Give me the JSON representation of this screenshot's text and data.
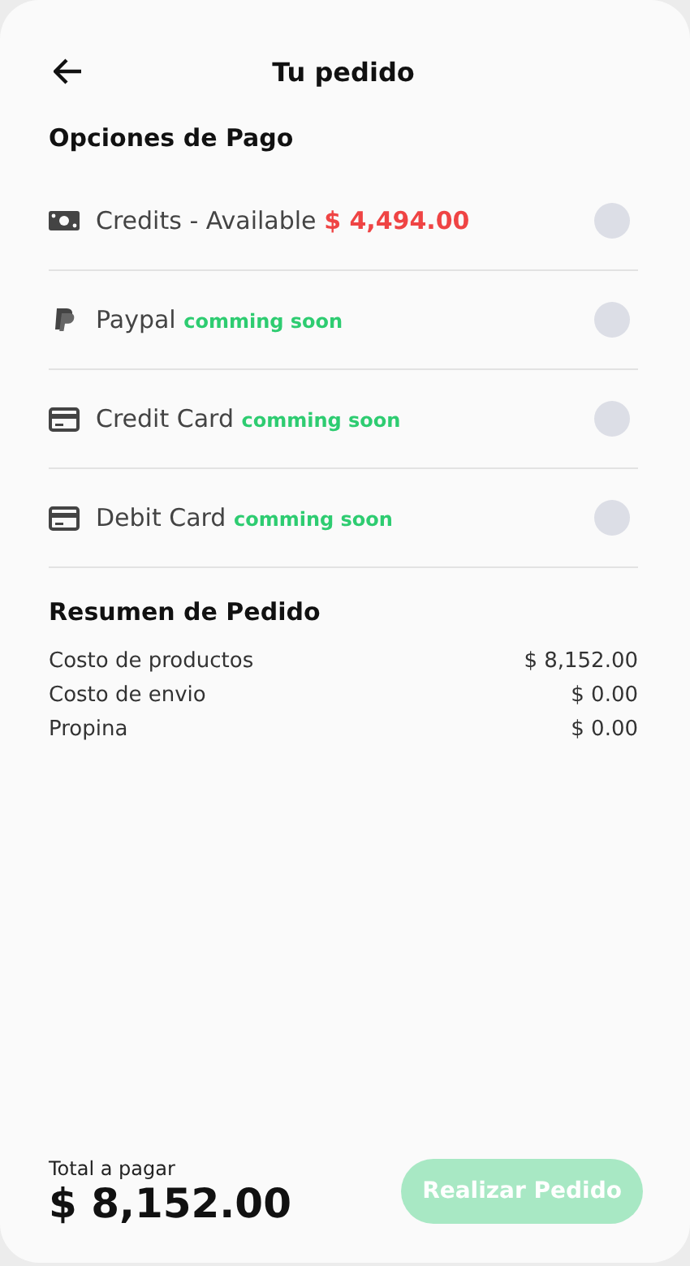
{
  "header": {
    "title": "Tu pedido"
  },
  "payment": {
    "title": "Opciones de Pago",
    "options": [
      {
        "kind": "money",
        "label": "Credits - Available",
        "note": {
          "kind": "amount",
          "text": "$ 4,494.00"
        },
        "selected": false
      },
      {
        "kind": "paypal",
        "label": "Paypal",
        "note": {
          "kind": "soon",
          "text": "comming soon"
        },
        "selected": false
      },
      {
        "kind": "card",
        "label": "Credit Card",
        "note": {
          "kind": "soon",
          "text": "comming soon"
        },
        "selected": false
      },
      {
        "kind": "card",
        "label": "Debit Card",
        "note": {
          "kind": "soon",
          "text": "comming soon"
        },
        "selected": false
      }
    ]
  },
  "summary": {
    "title": "Resumen de Pedido",
    "rows": [
      {
        "label": "Costo de productos",
        "value": "$ 8,152.00"
      },
      {
        "label": "Costo de envio",
        "value": "$ 0.00"
      },
      {
        "label": "Propina",
        "value": "$ 0.00"
      }
    ]
  },
  "footer": {
    "total_label": "Total a pagar",
    "total": "$ 8,152.00",
    "button": {
      "label": "Realizar Pedido",
      "disabled": true
    }
  }
}
